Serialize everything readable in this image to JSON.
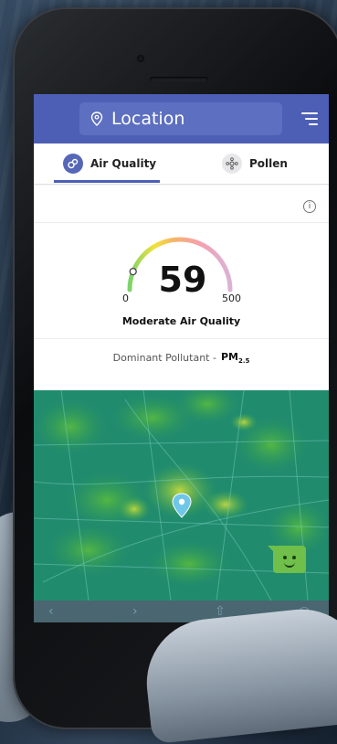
{
  "header": {
    "location_placeholder": "Location",
    "icons": [
      "location-pin-icon",
      "menu-icon"
    ]
  },
  "tabs": [
    {
      "label": "Air Quality",
      "icon": "air-quality-icon",
      "active": true
    },
    {
      "label": "Pollen",
      "icon": "pollen-icon",
      "active": false
    }
  ],
  "aqi": {
    "value": "59",
    "min": "0",
    "max": "500",
    "description": "Moderate Air Quality",
    "gauge_level": 0.118
  },
  "pollutant": {
    "label": "Dominant Pollutant -",
    "value": "PM",
    "subscript": "2.5"
  },
  "colors": {
    "header": "#4d5fb4",
    "accent": "#4d5fb4",
    "map_base": "#1f8a7c",
    "chat": "#6fbf4a"
  },
  "browser": {
    "icons": [
      "back-arrow-icon",
      "forward-arrow-icon",
      "share-icon",
      "tabs-icon"
    ]
  }
}
